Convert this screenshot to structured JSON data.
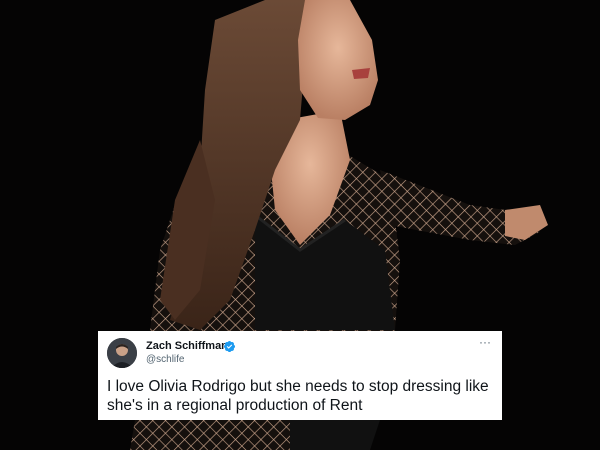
{
  "photo": {
    "description_icon": "photo-of-performer"
  },
  "tweet": {
    "display_name": "Zach Schiffman",
    "handle": "@schlife",
    "verified_icon": "verified-badge-icon",
    "more_icon": "more-options-icon",
    "more_glyph": "···",
    "text": "I love Olivia Rodrigo but she needs to stop dressing like she's in a regional production of Rent",
    "colors": {
      "verified": "#1d9bf0",
      "name": "#0f1419",
      "handle": "#536471"
    }
  }
}
